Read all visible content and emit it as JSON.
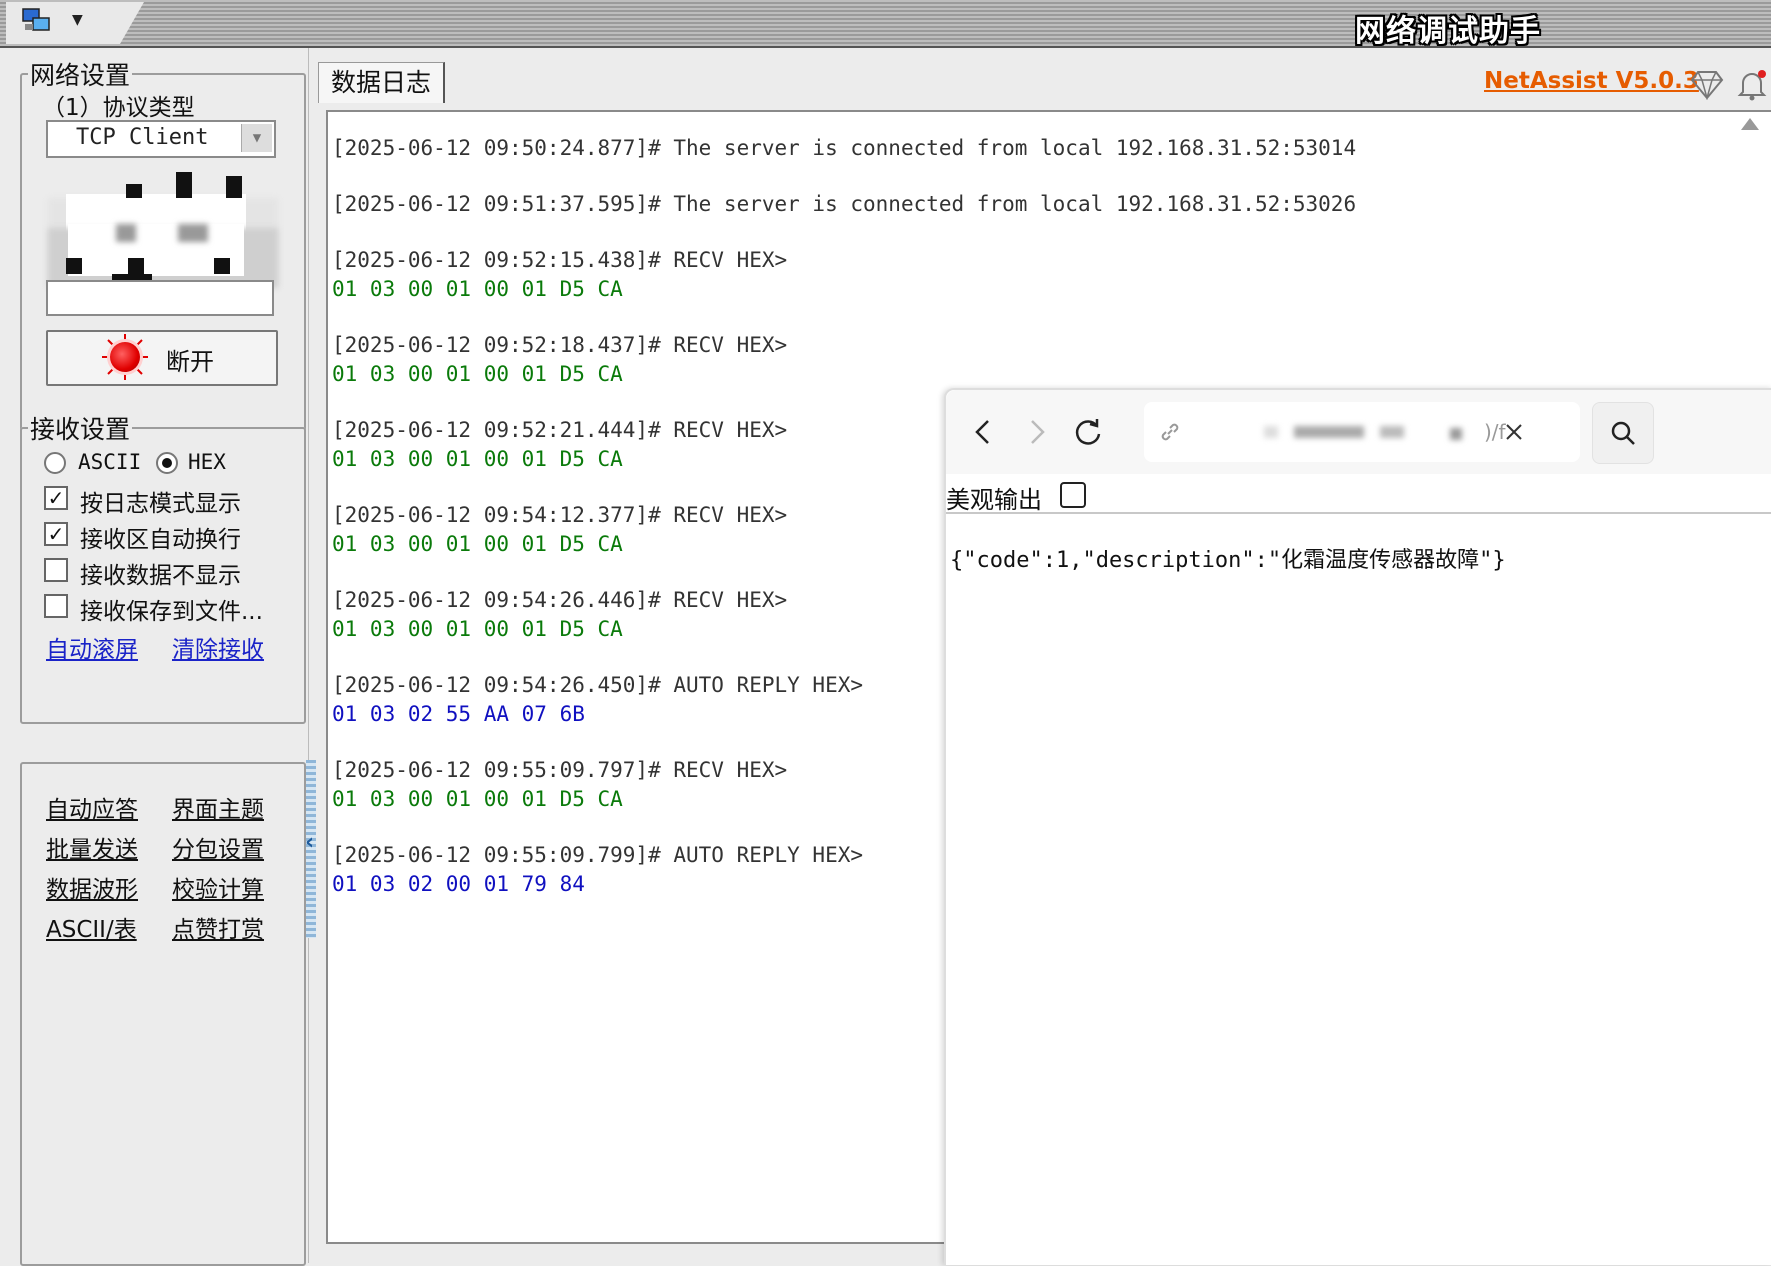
{
  "window": {
    "title": "网络调试助手",
    "version_link": "NetAssist V5.0.3"
  },
  "network_settings": {
    "legend": "网络设置",
    "protocol_label": "（1）协议类型",
    "protocol_value": "TCP Client",
    "disconnect_label": "断开"
  },
  "receive_settings": {
    "legend": "接收设置",
    "encoding_options": [
      "ASCII",
      "HEX"
    ],
    "encoding_selected": "HEX",
    "checkboxes": [
      {
        "label": "按日志模式显示",
        "checked": true
      },
      {
        "label": "接收区自动换行",
        "checked": true
      },
      {
        "label": "接收数据不显示",
        "checked": false
      },
      {
        "label": "接收保存到文件...",
        "checked": false
      }
    ],
    "links": [
      "自动滚屏",
      "清除接收"
    ]
  },
  "tools": [
    [
      "自动应答",
      "界面主题"
    ],
    [
      "批量发送",
      "分包设置"
    ],
    [
      "数据波形",
      "校验计算"
    ],
    [
      "ASCII/表",
      "点赞打赏"
    ]
  ],
  "tab": {
    "label": "数据日志"
  },
  "log": [
    {
      "header": "[2025-06-12 09:50:24.877]# The server is connected from local 192.168.31.52:53014",
      "data": "",
      "kind": "info"
    },
    {
      "header": "[2025-06-12 09:51:37.595]# The server is connected from local 192.168.31.52:53026",
      "data": "",
      "kind": "info"
    },
    {
      "header": "[2025-06-12 09:52:15.438]# RECV HEX>",
      "data": "01 03 00 01 00 01 D5 CA",
      "kind": "recv"
    },
    {
      "header": "[2025-06-12 09:52:18.437]# RECV HEX>",
      "data": "01 03 00 01 00 01 D5 CA",
      "kind": "recv"
    },
    {
      "header": "[2025-06-12 09:52:21.444]# RECV HEX>",
      "data": "01 03 00 01 00 01 D5 CA",
      "kind": "recv"
    },
    {
      "header": "[2025-06-12 09:54:12.377]# RECV HEX>",
      "data": "01 03 00 01 00 01 D5 CA",
      "kind": "recv"
    },
    {
      "header": "[2025-06-12 09:54:26.446]# RECV HEX>",
      "data": "01 03 00 01 00 01 D5 CA",
      "kind": "recv"
    },
    {
      "header": "[2025-06-12 09:54:26.450]# AUTO REPLY HEX>",
      "data": "01 03 02 55 AA 07 6B",
      "kind": "reply"
    },
    {
      "header": "[2025-06-12 09:55:09.797]# RECV HEX>",
      "data": "01 03 00 01 00 01 D5 CA",
      "kind": "recv"
    },
    {
      "header": "[2025-06-12 09:55:09.799]# AUTO REPLY HEX>",
      "data": "01 03 02 00 01 79 84",
      "kind": "reply"
    }
  ],
  "colors": {
    "recv": "#0a7a0a",
    "reply": "#1010c0",
    "version": "#e65c00",
    "link": "#1a23c8"
  },
  "browser": {
    "url_fragment": ")/f",
    "pretty_print_label": "美观输出",
    "pretty_print_checked": false,
    "json_text": "{\"code\":1,\"description\":\"化霜温度传感器故障\"}"
  },
  "icons": [
    "network-app-icon",
    "diamond-icon",
    "bell-icon",
    "back-icon",
    "forward-icon",
    "reload-icon",
    "link-icon",
    "clear-icon",
    "search-icon"
  ]
}
